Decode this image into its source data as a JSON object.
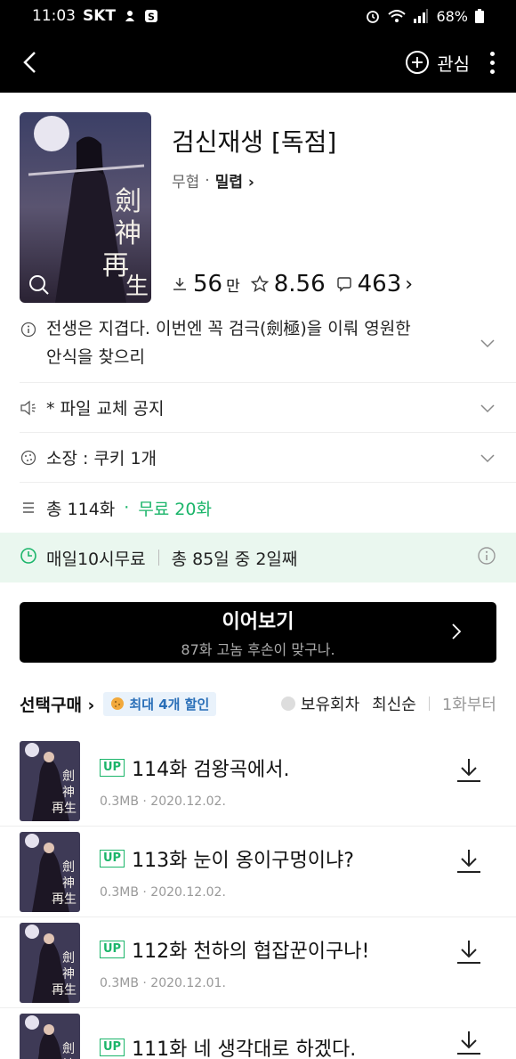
{
  "status_bar": {
    "time": "11:03",
    "carrier": "SKT",
    "battery": "68%"
  },
  "appbar": {
    "favorite_label": "관심"
  },
  "book": {
    "title": "검신재생 [독점]",
    "genre": "무협",
    "author": "밀렵",
    "downloads": "56",
    "downloads_unit": "만",
    "rating": "8.56",
    "comments": "463"
  },
  "rows": {
    "synopsis_line1": "전생은 지겹다. 이번엔 꼭 검극(劍極)을 이뤄 영원한",
    "synopsis_line2": "안식을 찾으리",
    "notice": "* 파일 교체 공지",
    "owned": "소장 : 쿠키 1개",
    "total": "총 114화",
    "free_count": "무료 20화"
  },
  "free_bar": {
    "label": "매일10시무료",
    "progress": "총 85일 중 2일째"
  },
  "continue_button": {
    "label": "이어보기",
    "subtitle": "87화 고놈 후손이 맞구나."
  },
  "purchase": {
    "select_label": "선택구매",
    "discount_badge": "최대 4개 할인",
    "owned_toggle": "보유회차",
    "sort_latest": "최신순",
    "sort_first": "1화부터"
  },
  "episodes": [
    {
      "badge": "UP",
      "title": "114화 검왕곡에서.",
      "meta": "0.3MB · 2020.12.02."
    },
    {
      "badge": "UP",
      "title": "113화 눈이 옹이구멍이냐?",
      "meta": "0.3MB · 2020.12.02."
    },
    {
      "badge": "UP",
      "title": "112화 천하의 협잡꾼이구나!",
      "meta": "0.3MB · 2020.12.01."
    },
    {
      "badge": "UP",
      "title": "111화 네 생각대로 하겠다.",
      "meta": ""
    }
  ],
  "colors": {
    "accent_green": "#1bb56a",
    "badge_blue": "#2a6fb8",
    "free_bar_bg": "#eaf7ef"
  }
}
